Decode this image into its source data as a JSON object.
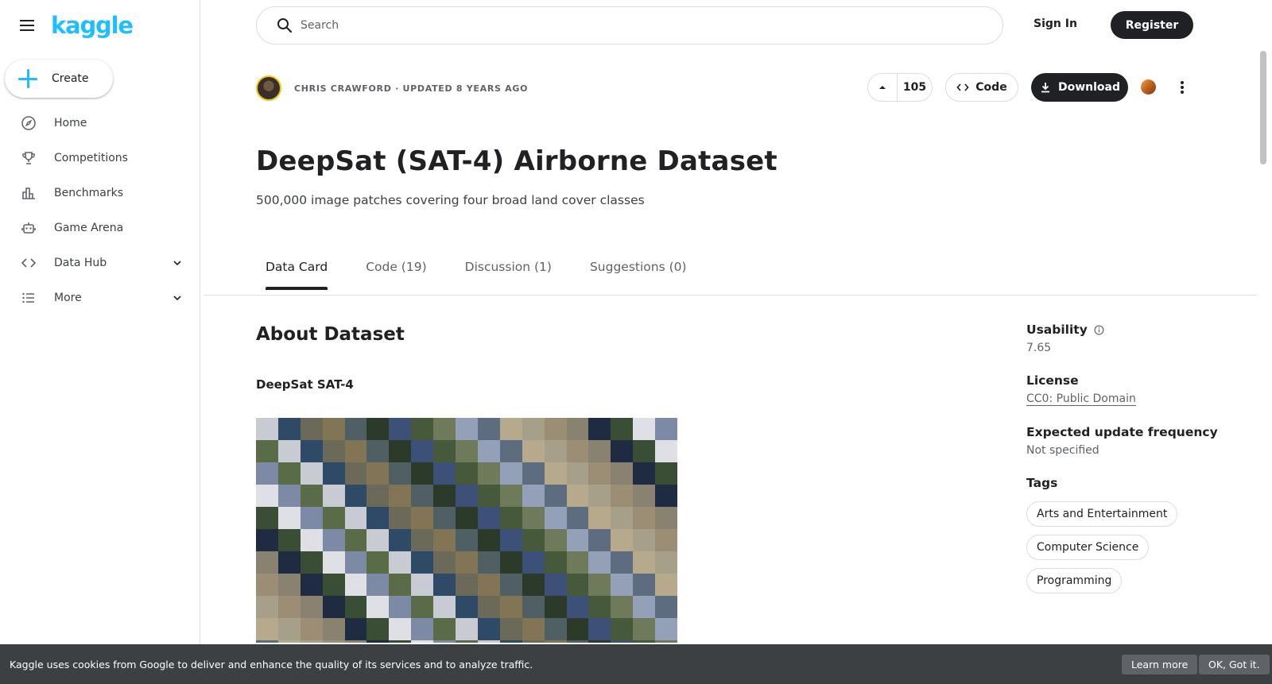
{
  "sidebar": {
    "logo": "kaggle",
    "create_label": "Create",
    "items": [
      {
        "label": "Home",
        "icon": "compass-icon"
      },
      {
        "label": "Competitions",
        "icon": "trophy-icon"
      },
      {
        "label": "Benchmarks",
        "icon": "bar-chart-icon"
      },
      {
        "label": "Game Arena",
        "icon": "robot-icon"
      },
      {
        "label": "Data Hub",
        "icon": "code-brackets-icon",
        "expandable": true
      },
      {
        "label": "More",
        "icon": "list-icon",
        "expandable": true
      }
    ]
  },
  "topbar": {
    "search_placeholder": "Search",
    "signin_label": "Sign In",
    "register_label": "Register"
  },
  "dataset": {
    "author_meta": "CHRIS CRAWFORD · UPDATED 8 YEARS AGO",
    "upvotes": "105",
    "code_label": "Code",
    "download_label": "Download",
    "title": "DeepSat (SAT-4) Airborne Dataset",
    "subtitle": "500,000 image patches covering four broad land cover classes"
  },
  "tabs": [
    {
      "label": "Data Card",
      "active": true
    },
    {
      "label": "Code (19)"
    },
    {
      "label": "Discussion (1)"
    },
    {
      "label": "Suggestions (0)"
    }
  ],
  "about": {
    "title": "About Dataset",
    "subtitle": "DeepSat SAT-4"
  },
  "meta": {
    "usability_label": "Usability",
    "usability_value": "7.65",
    "license_label": "License",
    "license_value": "CC0: Public Domain",
    "frequency_label": "Expected update frequency",
    "frequency_value": "Not specified",
    "tags_label": "Tags",
    "tags": [
      "Arts and Entertainment",
      "Computer Science",
      "Programming"
    ]
  },
  "cookie": {
    "text": "Kaggle uses cookies from Google to deliver and enhance the quality of its services and to analyze traffic.",
    "learn_more": "Learn more",
    "ok": "OK, Got it."
  },
  "colors": {
    "brand": "#20beff",
    "dark_button": "#202124",
    "cookie_bg": "#3c4043"
  }
}
